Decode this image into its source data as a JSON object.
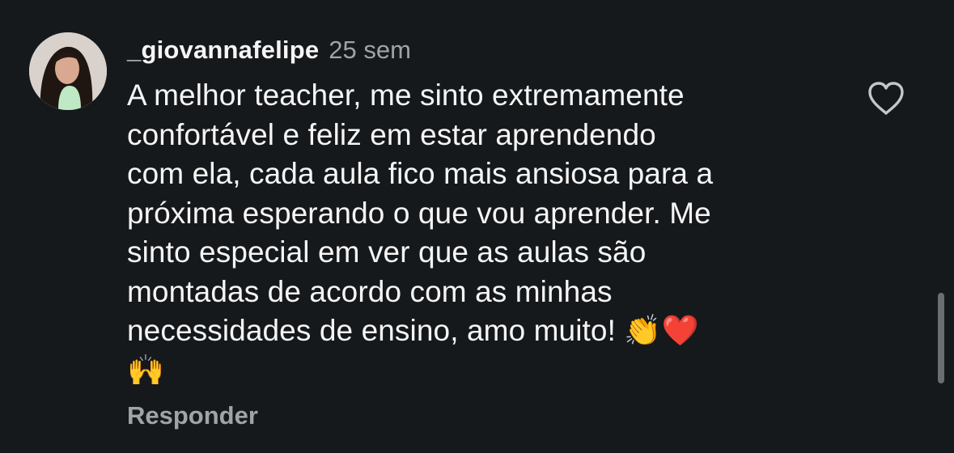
{
  "comment": {
    "username": "_giovannafelipe",
    "timestamp": "25 sem",
    "lines": [
      "A melhor teacher, me sinto extremamente",
      "confortável e feliz em estar aprendendo",
      "com ela, cada aula fico mais ansiosa para a",
      "próxima esperando o que vou aprender. Me",
      "sinto especial em ver que as aulas são",
      "montadas de acordo com as minhas",
      "necessidades de ensino, amo muito!"
    ],
    "emoji_inline": [
      "👏",
      "❤️"
    ],
    "emoji_last_line": "🙌",
    "reply_label": "Responder"
  },
  "icons": {
    "like": "heart-outline-icon",
    "avatar": "profile-photo"
  },
  "colors": {
    "background": "#16191c",
    "text_primary": "#f5f5f5",
    "text_secondary": "#a0a3a7",
    "scrollbar": "#6a6d71"
  }
}
